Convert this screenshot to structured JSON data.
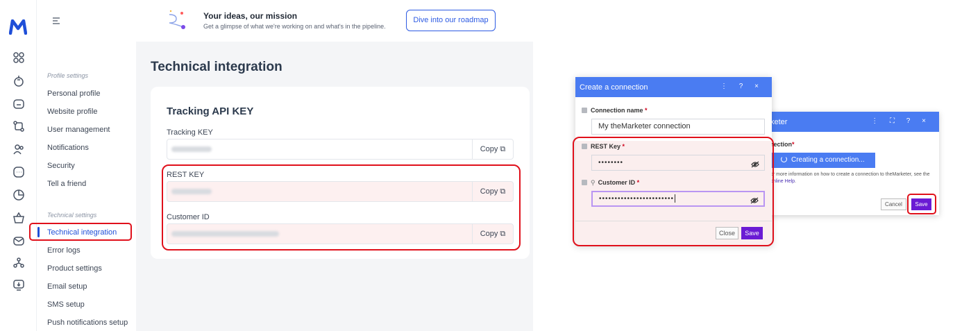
{
  "sidebar": {
    "logo": "M",
    "icons": [
      "dashboard-icon",
      "deals-icon",
      "folder-icon",
      "flow-icon",
      "audience-icon",
      "message-icon",
      "analytics-icon",
      "basket-icon",
      "email-icon",
      "network-icon",
      "download-icon"
    ]
  },
  "subnav": {
    "profile_section": "Profile settings",
    "profile_items": [
      "Personal profile",
      "Website profile",
      "User management",
      "Notifications",
      "Security",
      "Tell a friend"
    ],
    "technical_section": "Technical settings",
    "technical_items": [
      "Technical integration",
      "Error logs",
      "Product settings",
      "Email setup",
      "SMS setup",
      "Push notifications setup"
    ]
  },
  "banner": {
    "title": "Your ideas, our mission",
    "subtitle": "Get a glimpse of what we're working on and what's in the pipeline.",
    "button": "Dive into our roadmap"
  },
  "page": {
    "title": "Technical integration",
    "card_title": "Tracking API KEY",
    "fields": [
      {
        "label": "Tracking KEY",
        "copy": "Copy"
      },
      {
        "label": "REST KEY",
        "copy": "Copy"
      },
      {
        "label": "Customer ID",
        "copy": "Copy"
      }
    ]
  },
  "dialog_connection": {
    "title": "Create a connection",
    "controls": "⋮ ? ×",
    "name_label": "Connection name",
    "name_value": "My theMarketer connection",
    "rest_label": "REST Key",
    "rest_value": "••••••••",
    "customer_label": "Customer ID",
    "customer_value": "••••••••••••••••••••••••",
    "required": "*",
    "close": "Close",
    "save": "Save"
  },
  "dialog_back": {
    "title": "keter",
    "controls": "⋮ ⛶ ? ×",
    "label": "nection",
    "creating": "Creating a connection...",
    "help_prefix": "or more information on how to create a connection to theMarketer, see the ",
    "help_link": "online Help",
    "help_suffix": ".",
    "cancel": "Cancel",
    "save": "Save"
  },
  "colors": {
    "accent_blue": "#2d5be3",
    "dialog_header": "#4a7cf2",
    "save_purple": "#6a1bd4",
    "highlight_red": "#e0101b"
  }
}
